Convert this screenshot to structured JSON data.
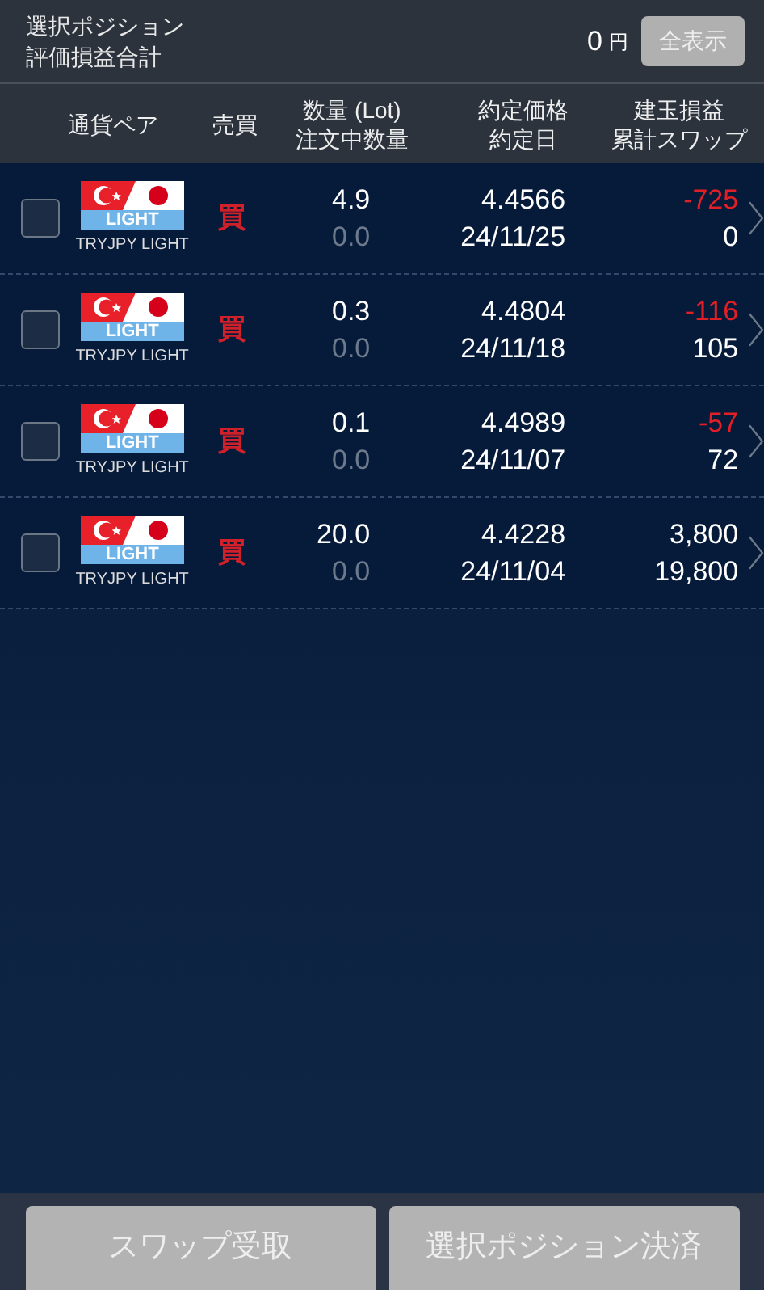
{
  "summary": {
    "label_line1": "選択ポジション",
    "label_line2": "評価損益合計",
    "amount": "0",
    "unit": "円",
    "show_all_button": "全表示"
  },
  "columns": [
    {
      "line1": "通貨ペア"
    },
    {
      "line1": "売買"
    },
    {
      "line1": "数量 (Lot)",
      "line2": "注文中数量"
    },
    {
      "line1": "約定価格",
      "line2": "約定日"
    },
    {
      "line1": "建玉損益",
      "line2": "累計スワップ"
    }
  ],
  "positions": [
    {
      "checked": false,
      "flag_label": "LIGHT",
      "pair": "TRYJPY LIGHT",
      "side": "買",
      "quantity": "4.9",
      "pending": "0.0",
      "price": "4.4566",
      "date": "24/11/25",
      "pnl": "-725",
      "loss": true,
      "swap": "0"
    },
    {
      "checked": false,
      "flag_label": "LIGHT",
      "pair": "TRYJPY LIGHT",
      "side": "買",
      "quantity": "0.3",
      "pending": "0.0",
      "price": "4.4804",
      "date": "24/11/18",
      "pnl": "-116",
      "loss": true,
      "swap": "105"
    },
    {
      "checked": false,
      "flag_label": "LIGHT",
      "pair": "TRYJPY LIGHT",
      "side": "買",
      "quantity": "0.1",
      "pending": "0.0",
      "price": "4.4989",
      "date": "24/11/07",
      "pnl": "-57",
      "loss": true,
      "swap": "72"
    },
    {
      "checked": false,
      "flag_label": "LIGHT",
      "pair": "TRYJPY LIGHT",
      "side": "買",
      "quantity": "20.0",
      "pending": "0.0",
      "price": "4.4228",
      "date": "24/11/04",
      "pnl": "3,800",
      "loss": false,
      "swap": "19,800"
    }
  ],
  "buttons": [
    {
      "label": "スワップ受取",
      "disabled": true
    },
    {
      "label": "選択ポジション決済",
      "disabled": true
    }
  ]
}
